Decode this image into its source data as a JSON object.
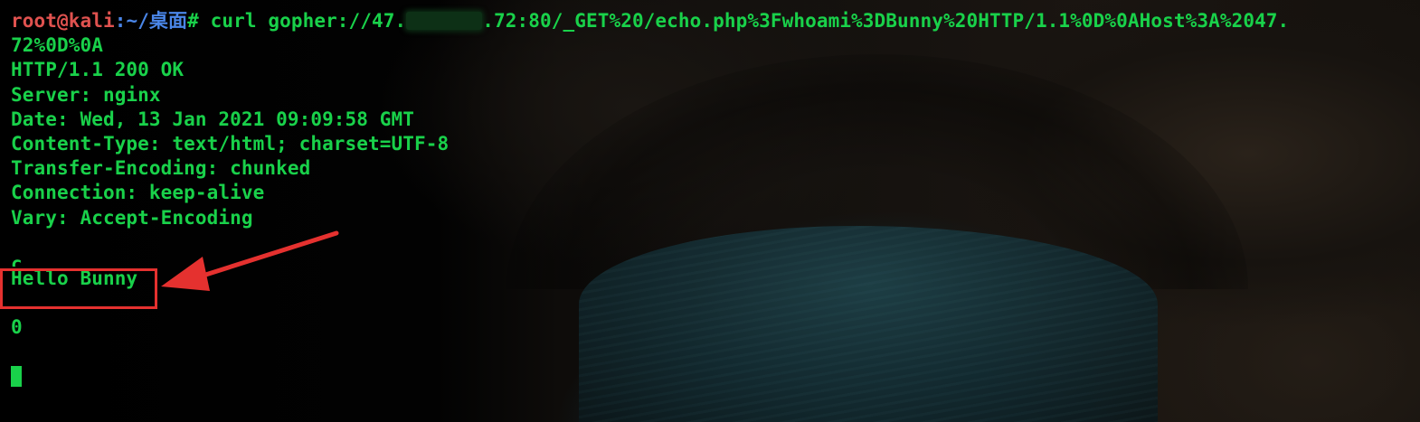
{
  "prompt": {
    "user": "root@kali",
    "path": ":~/桌面",
    "symbol": "#"
  },
  "command": {
    "part1": " curl gopher://47.",
    "part2": ".72:80/_GET%20/echo.php%3Fwhoami%3DBunny%20HTTP/1.1%0D%0AHost%3A%2047.",
    "wrap": "72%0D%0A"
  },
  "response": {
    "status": "HTTP/1.1 200 OK",
    "server": "Server: nginx",
    "date": "Date: Wed, 13 Jan 2021 09:09:58 GMT",
    "content_type": "Content-Type: text/html; charset=UTF-8",
    "transfer_encoding": "Transfer-Encoding: chunked",
    "connection": "Connection: keep-alive",
    "vary": "Vary: Accept-Encoding",
    "chunk_size": "c",
    "body": "Hello Bunny",
    "terminator": "0"
  },
  "colors": {
    "text": "#19d14a",
    "prompt_user": "#e0524f",
    "prompt_path": "#4a86e8",
    "annotation": "#e5312f"
  }
}
